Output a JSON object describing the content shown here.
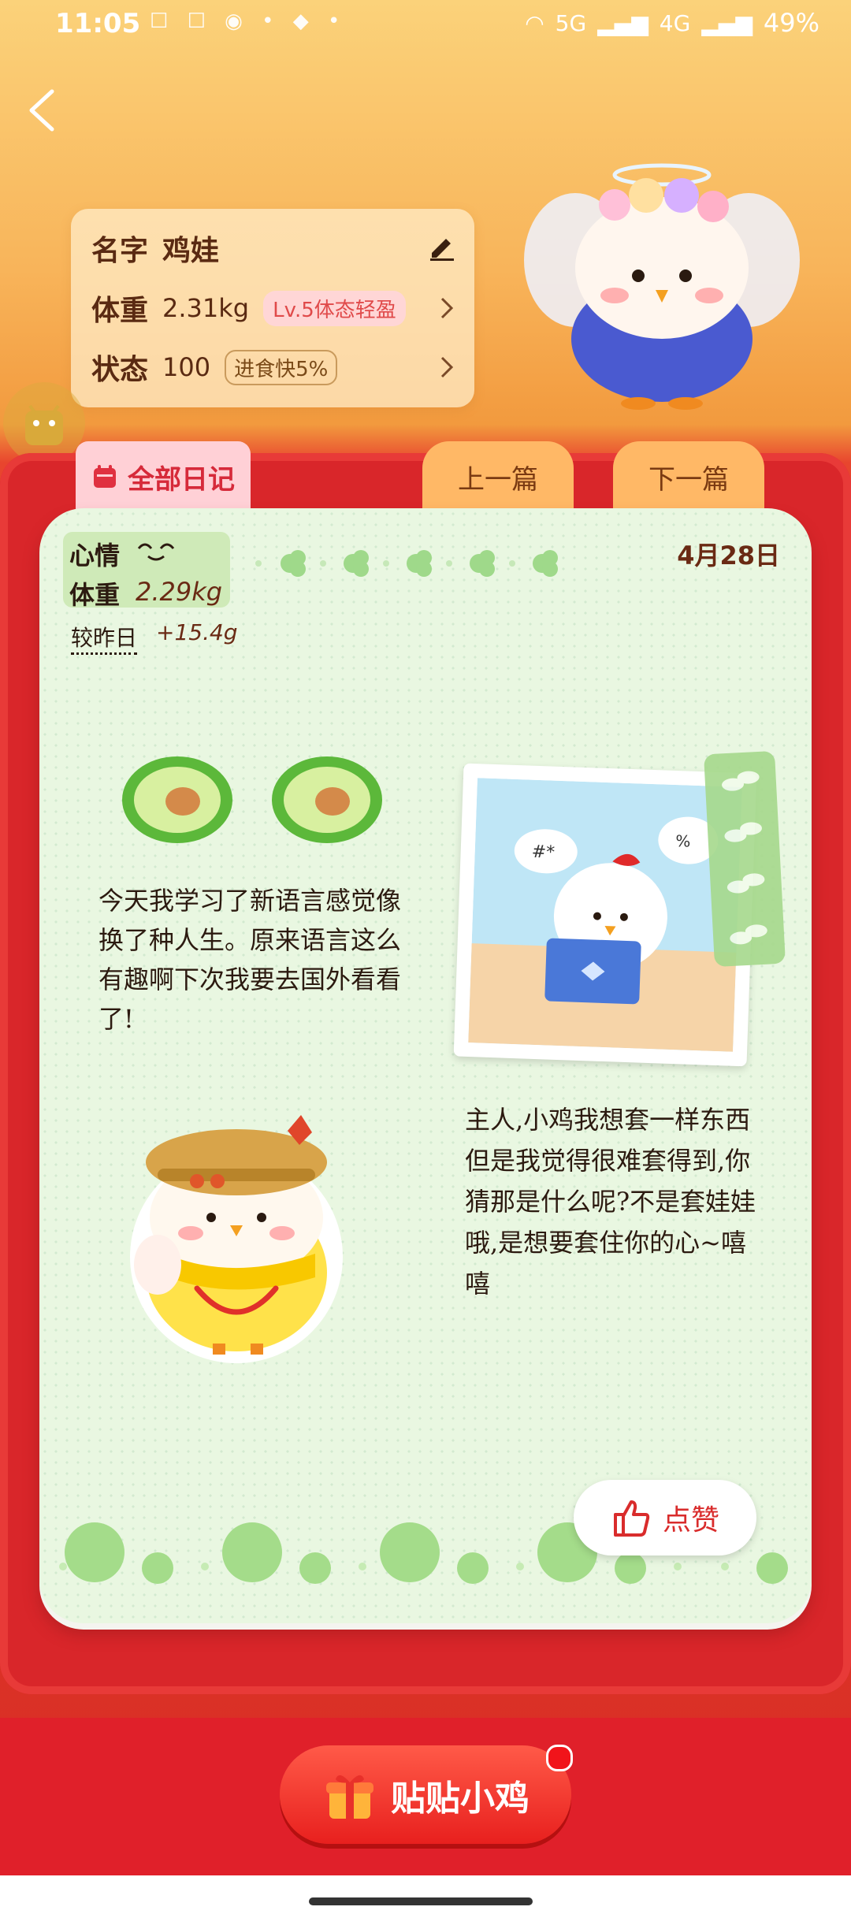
{
  "status_bar": {
    "time": "11:05",
    "network_5g": "5G",
    "network_4g": "4G",
    "battery": "49%"
  },
  "pet_info": {
    "name_label": "名字",
    "name_value": "鸡娃",
    "weight_label": "体重",
    "weight_value": "2.31kg",
    "weight_badge": "Lv.5体态轻盈",
    "status_label": "状态",
    "status_value": "100",
    "status_badge": "进食快5%"
  },
  "tabs": {
    "all_diary": "全部日记",
    "prev": "上一篇",
    "next": "下一篇"
  },
  "diary": {
    "mood_label": "心情",
    "weight_label": "体重",
    "weight_value": "2.29kg",
    "compare_label": "较昨日",
    "compare_value": "+15.4g",
    "date": "4月28日",
    "text_left": "今天我学习了新语言感觉像换了种人生。原来语言这么有趣啊下次我要去国外看看了!",
    "text_right": "主人,小鸡我想套一样东西但是我觉得很难套得到,你猜那是什么呢?不是套娃娃哦,是想要套住你的心~嘻嘻",
    "like_label": "点赞"
  },
  "bottom": {
    "main_button": "贴贴小鸡"
  },
  "colors": {
    "board_red": "#d9262a",
    "diary_green": "#e9f7e1",
    "accent_orange": "#ffb866"
  }
}
